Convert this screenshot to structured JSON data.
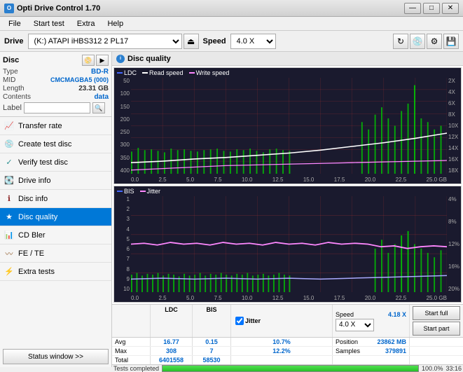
{
  "titleBar": {
    "title": "Opti Drive Control 1.70",
    "controls": [
      "—",
      "□",
      "✕"
    ]
  },
  "menuBar": {
    "items": [
      "File",
      "Start test",
      "Extra",
      "Help"
    ]
  },
  "driveToolbar": {
    "driveLabel": "Drive",
    "driveValue": "(K:)  ATAPI iHBS312  2 PL17",
    "speedLabel": "Speed",
    "speedValue": "4.0 X"
  },
  "discSection": {
    "title": "Disc",
    "fields": [
      {
        "label": "Type",
        "value": "BD-R",
        "color": "blue"
      },
      {
        "label": "MID",
        "value": "CMCMAGBA5 (000)",
        "color": "blue"
      },
      {
        "label": "Length",
        "value": "23.31 GB",
        "color": "dark"
      },
      {
        "label": "Contents",
        "value": "data",
        "color": "blue"
      }
    ],
    "labelField": {
      "placeholder": "",
      "value": ""
    }
  },
  "navItems": [
    {
      "id": "transfer-rate",
      "label": "Transfer rate",
      "icon": "chart-icon"
    },
    {
      "id": "create-test-disc",
      "label": "Create test disc",
      "icon": "disc-create-icon"
    },
    {
      "id": "verify-test-disc",
      "label": "Verify test disc",
      "icon": "verify-icon"
    },
    {
      "id": "drive-info",
      "label": "Drive info",
      "icon": "drive-icon"
    },
    {
      "id": "disc-info",
      "label": "Disc info",
      "icon": "disc-info-icon"
    },
    {
      "id": "disc-quality",
      "label": "Disc quality",
      "icon": "quality-icon",
      "active": true
    },
    {
      "id": "cd-bler",
      "label": "CD Bler",
      "icon": "cd-icon"
    },
    {
      "id": "fe-te",
      "label": "FE / TE",
      "icon": "fete-icon"
    },
    {
      "id": "extra-tests",
      "label": "Extra tests",
      "icon": "extra-icon"
    }
  ],
  "statusWindow": {
    "label": "Status window >>"
  },
  "discQuality": {
    "title": "Disc quality"
  },
  "chart1": {
    "legend": [
      {
        "label": "LDC",
        "color": "#4444ff"
      },
      {
        "label": "Read speed",
        "color": "white"
      },
      {
        "label": "Write speed",
        "color": "#ff88ff"
      }
    ],
    "yAxisLeft": [
      "400",
      "350",
      "300",
      "250",
      "200",
      "150",
      "100",
      "50"
    ],
    "yAxisRight": [
      "18X",
      "16X",
      "14X",
      "12X",
      "10X",
      "8X",
      "6X",
      "4X",
      "2X"
    ],
    "xAxis": [
      "0.0",
      "2.5",
      "5.0",
      "7.5",
      "10.0",
      "12.5",
      "15.0",
      "17.5",
      "20.0",
      "22.5",
      "25.0 GB"
    ]
  },
  "chart2": {
    "legend": [
      {
        "label": "BIS",
        "color": "#4444ff"
      },
      {
        "label": "Jitter",
        "color": "#ff88ff"
      }
    ],
    "yAxisLeft": [
      "10",
      "9",
      "8",
      "7",
      "6",
      "5",
      "4",
      "3",
      "2",
      "1"
    ],
    "yAxisRight": [
      "20%",
      "16%",
      "12%",
      "8%",
      "4%"
    ],
    "xAxis": [
      "0.0",
      "2.5",
      "5.0",
      "7.5",
      "10.0",
      "12.5",
      "15.0",
      "17.5",
      "20.0",
      "22.5",
      "25.0 GB"
    ]
  },
  "statsTable": {
    "headers": [
      "LDC",
      "BIS",
      "Jitter"
    ],
    "rows": [
      {
        "label": "Avg",
        "ldc": "16.77",
        "bis": "0.15",
        "jitter": "10.7%"
      },
      {
        "label": "Max",
        "ldc": "308",
        "bis": "7",
        "jitter": "12.2%"
      },
      {
        "label": "Total",
        "ldc": "6401558",
        "bis": "58530",
        "jitter": ""
      }
    ]
  },
  "speedInfo": {
    "speedLabel": "Speed",
    "speedValue": "4.18 X",
    "positionLabel": "Position",
    "positionValue": "23862 MB",
    "samplesLabel": "Samples",
    "samplesValue": "379891"
  },
  "speedSelect": {
    "value": "4.0 X"
  },
  "actionButtons": {
    "startFull": "Start full",
    "startPart": "Start part"
  },
  "progressBar": {
    "percent": 100,
    "percentText": "100.0%",
    "time": "33:16"
  },
  "statusBar": {
    "text": "Tests completed"
  }
}
